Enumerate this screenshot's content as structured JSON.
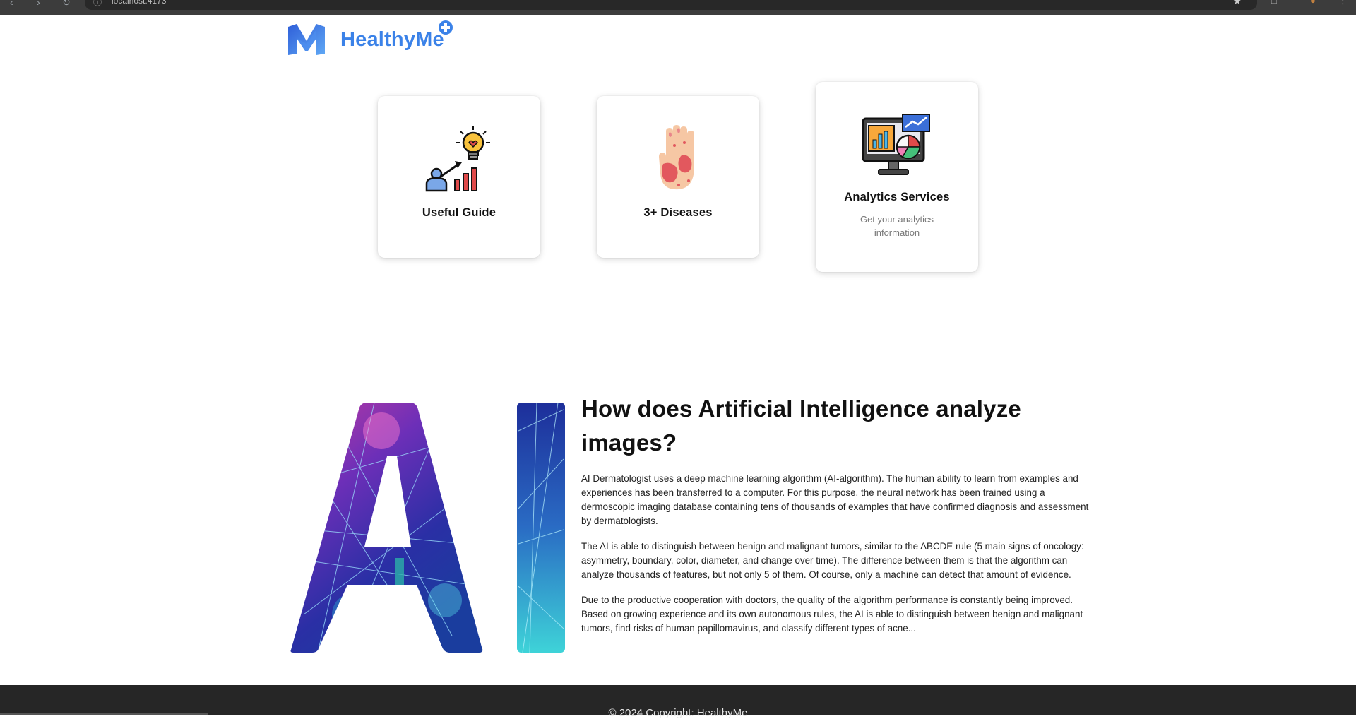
{
  "browser": {
    "url": "localhost:4173",
    "icons": [
      "back-icon",
      "forward-icon",
      "reload-icon",
      "site-info-icon",
      "bookmark-star-icon",
      "extension-icon",
      "profile-icon",
      "menu-kebab-icon"
    ]
  },
  "header": {
    "brand": "HealthyMe",
    "brand_color": "#3b82e8",
    "icons": [
      "logo-m-icon",
      "plus-badge-icon"
    ]
  },
  "cards": [
    {
      "title": "Useful Guide",
      "subtitle": "",
      "icon": "guide-lightbulb-icon"
    },
    {
      "title": "3+ Diseases",
      "subtitle": "",
      "icon": "skin-hand-icon"
    },
    {
      "title": "Analytics Services",
      "subtitle": "Get your analytics information",
      "icon": "analytics-monitor-icon"
    }
  ],
  "ai_section": {
    "heading": "How does Artificial Intelligence analyze images?",
    "paragraphs": [
      "AI Dermatologist uses a deep machine learning algorithm (AI-algorithm). The human ability to learn from examples and experiences has been transferred to a computer. For this purpose, the neural network has been trained using a dermoscopic imaging database containing tens of thousands of examples that have confirmed diagnosis and assessment by dermatologists.",
      "The AI is able to distinguish between benign and malignant tumors, similar to the ABCDE rule (5 main signs of oncology: asymmetry, boundary, color, diameter, and change over time). The difference between them is that the algorithm can analyze thousands of features, but not only 5 of them. Of course, only a machine can detect that amount of evidence.",
      "Due to the productive cooperation with doctors, the quality of the algorithm performance is constantly being improved. Based on growing experience and its own autonomous rules, the AI is able to distinguish between benign and malignant tumors, find risks of human papillomavirus, and classify different types of acne..."
    ]
  },
  "footer": {
    "copyright": "© 2024 Copyright: HealthyMe",
    "background": "#262626"
  }
}
